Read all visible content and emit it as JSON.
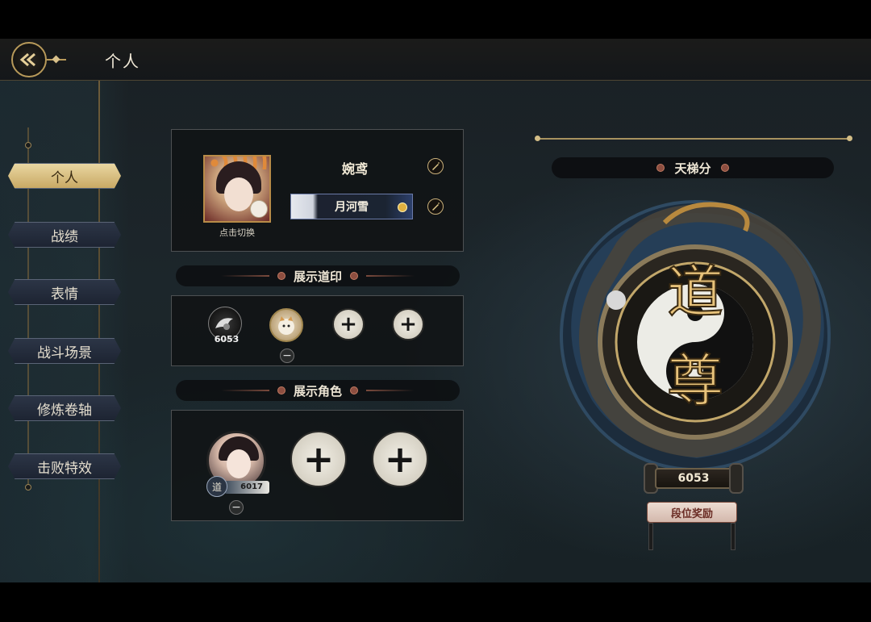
{
  "header": {
    "title": "个人",
    "back_icon": "back-arrow-icon"
  },
  "sidebar": {
    "items": [
      {
        "label": "个人",
        "active": true
      },
      {
        "label": "战绩",
        "active": false
      },
      {
        "label": "表情",
        "active": false
      },
      {
        "label": "战斗场景",
        "active": false
      },
      {
        "label": "修炼卷轴",
        "active": false
      },
      {
        "label": "击败特效",
        "active": false
      }
    ]
  },
  "profile": {
    "switch_label": "点击切换",
    "nickname": "婉鸢",
    "title_badge": "月河雪"
  },
  "seals": {
    "section_title": "展示道印",
    "rank_seal_value": "6053"
  },
  "characters": {
    "section_title": "展示角色",
    "character_score": "6017",
    "rank_glyph": "道"
  },
  "ladder": {
    "title": "天梯分",
    "rank_name": "道尊",
    "score": "6053",
    "reward_label": "段位奖励"
  },
  "colors": {
    "accent_gold": "#c9a964",
    "panel_bg": "#101214",
    "navy": "#1e3550"
  }
}
